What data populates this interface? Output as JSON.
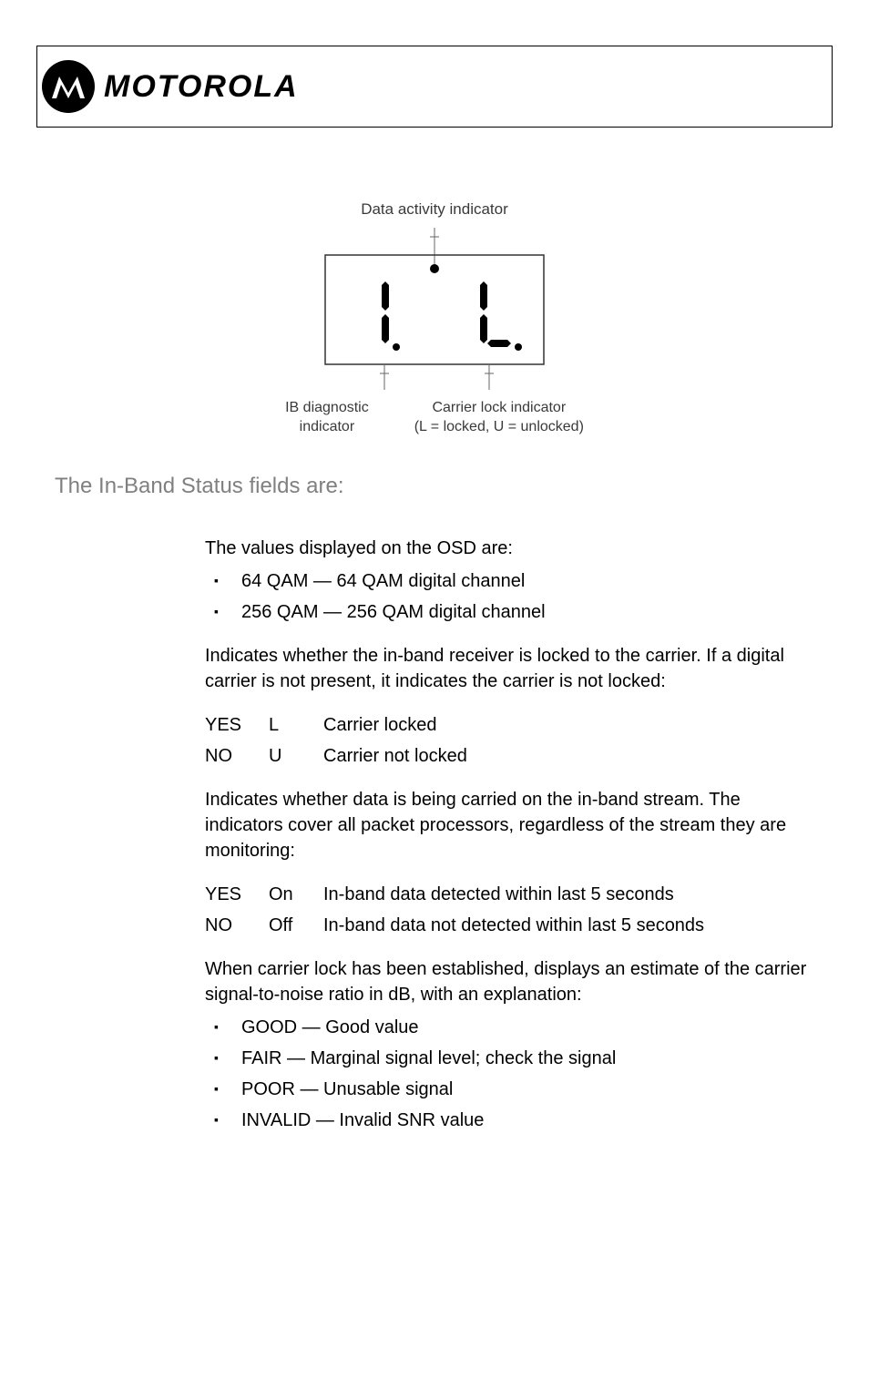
{
  "header": {
    "brand": "MOTOROLA"
  },
  "diagram": {
    "top_label": "Data activity indicator",
    "bottom_left_line1": "IB diagnostic",
    "bottom_left_line2": "indicator",
    "bottom_right_line1": "Carrier lock indicator",
    "bottom_right_line2": "(L = locked, U = unlocked)"
  },
  "section_title": "The In-Band Status fields are:",
  "content": {
    "osd_intro": "The values displayed on the OSD are:",
    "osd_items": [
      "64 QAM — 64 QAM digital channel",
      "256 QAM — 256 QAM digital channel"
    ],
    "carrier_lock_intro": "Indicates whether the in-band receiver is locked to the carrier. If a digital carrier is not present, it indicates the carrier is not locked:",
    "carrier_table": [
      {
        "osd": "YES",
        "led": "L",
        "desc": "Carrier locked"
      },
      {
        "osd": "NO",
        "led": "U",
        "desc": "Carrier not locked"
      }
    ],
    "data_intro": "Indicates whether data is being carried on the in-band stream. The indicators cover all packet processors, regardless of the stream they are monitoring:",
    "data_table": [
      {
        "osd": "YES",
        "led": "On",
        "desc": "In-band data detected within last 5 seconds"
      },
      {
        "osd": "NO",
        "led": "Off",
        "desc": "In-band data not detected within last 5 seconds"
      }
    ],
    "snr_intro": "When carrier lock has been established, displays an estimate of the carrier signal-to-noise ratio in dB, with an explanation:",
    "snr_items": [
      "GOOD — Good value",
      "FAIR — Marginal signal level; check the signal",
      "POOR — Unusable signal",
      "INVALID — Invalid SNR value"
    ]
  }
}
